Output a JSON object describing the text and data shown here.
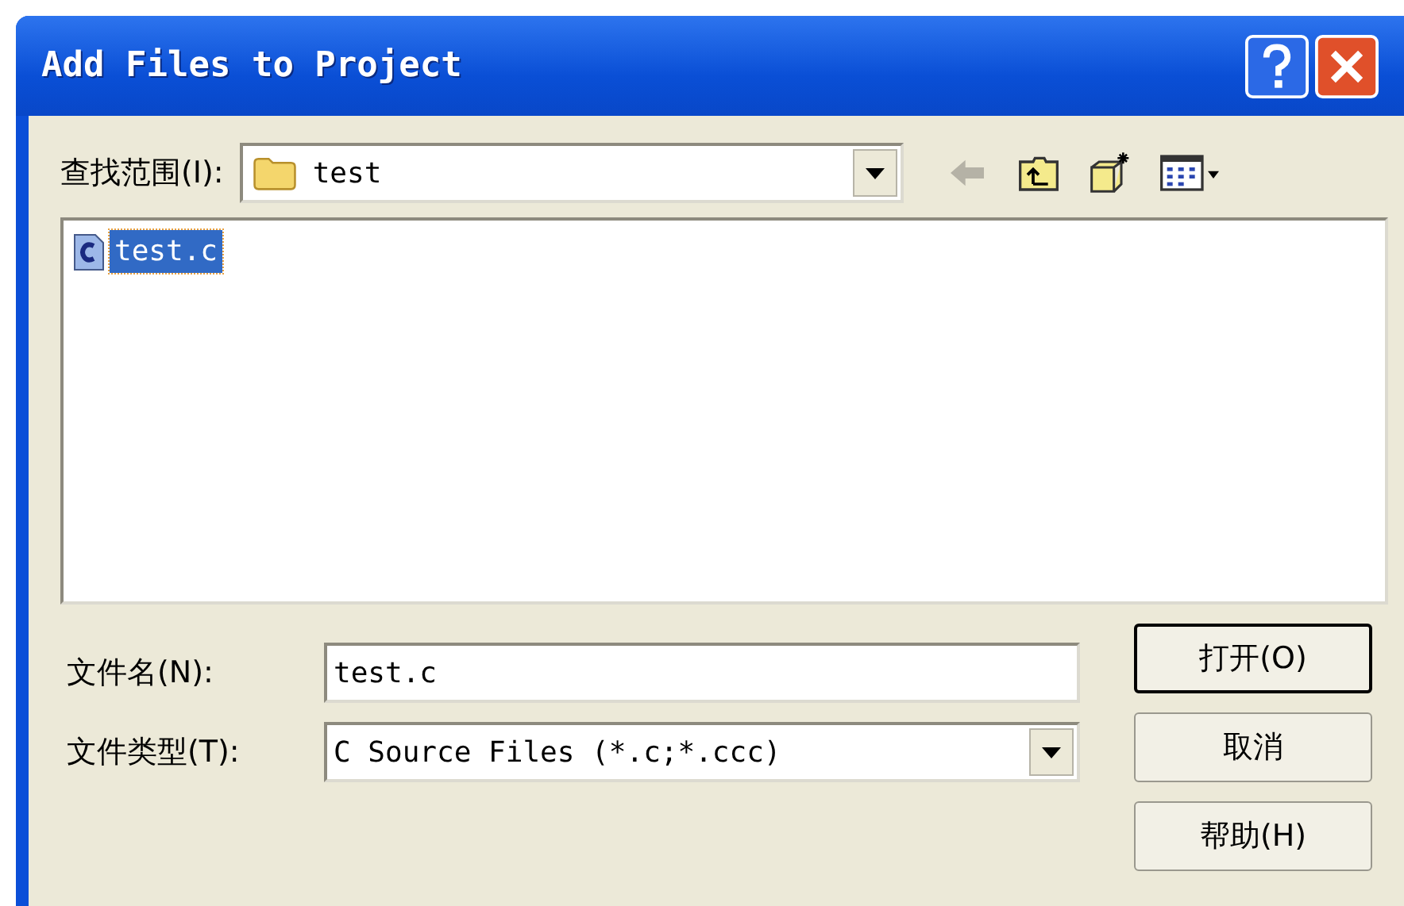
{
  "window": {
    "title": "Add Files to Project"
  },
  "look_in": {
    "label": "查找范围(I):",
    "value": "test"
  },
  "files": [
    {
      "name": "test.c",
      "selected": true
    }
  ],
  "file_name": {
    "label": "文件名(N):",
    "value": "test.c"
  },
  "file_type": {
    "label": "文件类型(T):",
    "value": "C Source Files (*.c;*.ccc)"
  },
  "buttons": [
    {
      "label": "打开(O)",
      "default": true
    },
    {
      "label": "取消",
      "default": false
    },
    {
      "label": "帮助(H)",
      "default": false
    }
  ]
}
